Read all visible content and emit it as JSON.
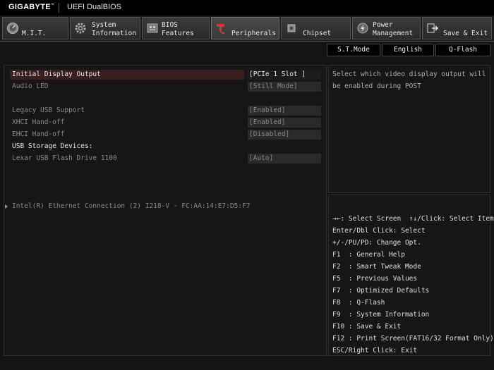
{
  "topbar": {
    "brand": "GIGABYTE",
    "brand_mark": "™",
    "product": "UEFI DualBIOS"
  },
  "tabs": [
    {
      "line1": "M.I.T.",
      "line2": "",
      "icon": "gauge-icon",
      "active": false
    },
    {
      "line1": "System",
      "line2": "Information",
      "icon": "gear-icon",
      "active": false
    },
    {
      "line1": "BIOS",
      "line2": "Features",
      "icon": "bios-chip-icon",
      "active": false
    },
    {
      "line1": "Peripherals",
      "line2": "",
      "icon": "peripheral-plug-icon",
      "active": true
    },
    {
      "line1": "Chipset",
      "line2": "",
      "icon": "chip-icon",
      "active": false
    },
    {
      "line1": "Power",
      "line2": "Management",
      "icon": "power-icon",
      "active": false
    },
    {
      "line1": "Save & Exit",
      "line2": "",
      "icon": "exit-icon",
      "active": false
    }
  ],
  "shortcuts": {
    "st_mode": "S.T.Mode",
    "language": "English",
    "qflash": "Q-Flash"
  },
  "settings": {
    "initial_display": {
      "label": "Initial Display Output",
      "value": "[PCIe 1 Slot ]"
    },
    "audio_led": {
      "label": "Audio LED",
      "value": "[Still Mode]"
    },
    "legacy_usb": {
      "label": "Legacy USB Support",
      "value": "[Enabled]"
    },
    "xhci": {
      "label": "XHCI Hand-off",
      "value": "[Enabled]"
    },
    "ehci": {
      "label": "EHCI Hand-off",
      "value": "[Disabled]"
    },
    "usb_storage_header": "USB Storage Devices:",
    "lexar": {
      "label": "Lexar USB Flash Drive 1100",
      "value": "[Auto]"
    },
    "ethernet": "Intel(R) Ethernet Connection (2) I218-V - FC:AA:14:E7:D5:F7"
  },
  "help": {
    "text": "Select which video display output will be enabled during POST"
  },
  "keys": [
    "→←: Select Screen  ↑↓/Click: Select Item",
    "Enter/Dbl Click: Select",
    "+/-/PU/PD: Change Opt.",
    "F1  : General Help",
    "F2  : Smart Tweak Mode",
    "F5  : Previous Values",
    "F7  : Optimized Defaults",
    "F8  : Q-Flash",
    "F9  : System Information",
    "F10 : Save & Exit",
    "F12 : Print Screen(FAT16/32 Format Only)",
    "ESC/Right Click: Exit"
  ]
}
